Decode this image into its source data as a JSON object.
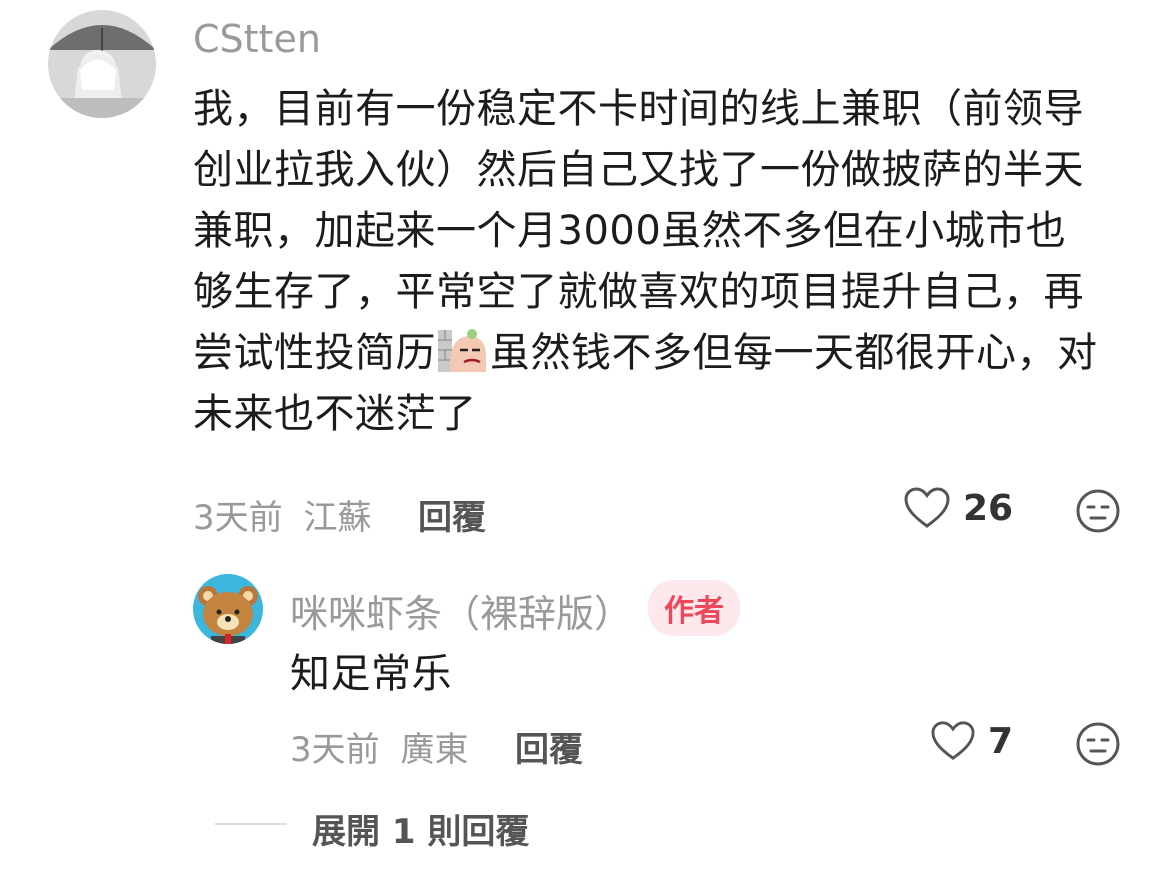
{
  "comment": {
    "username": "CStten",
    "text_lines": [
      "我，目前有一份稳定不卡时间的线上兼职（前领导",
      "创业拉我入伙）然后自己又找了一份做披萨的半天",
      "兼职，加起来一个月3000虽然不多但在小城市也",
      "够生存了，平常空了就做喜欢的项目提升自己，再"
    ],
    "line5_before": "尝试性投简历",
    "line5_after": "虽然钱不多但每一天都很开心，对",
    "line6": "未来也不迷茫了",
    "time": "3天前",
    "location": "江蘇",
    "reply_label": "回覆",
    "likes": "26",
    "avatar_icon": "girl-umbrella-avatar",
    "sticker_icon": "smug-sticker-icon"
  },
  "reply": {
    "username": "咪咪虾条（裸辞版）",
    "badge": "作者",
    "text": "知足常乐",
    "time": "3天前",
    "location": "廣東",
    "reply_label": "回覆",
    "likes": "7",
    "avatar_icon": "bear-avatar"
  },
  "expand_label": "展開 1 則回覆",
  "colors": {
    "badge_bg": "#fde9ec",
    "badge_text": "#f0465b",
    "meta_text": "#999999"
  }
}
